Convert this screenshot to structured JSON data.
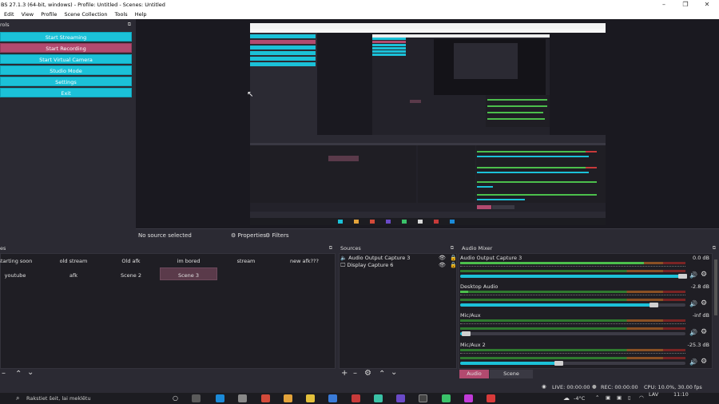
{
  "window": {
    "title": "BS 27.1.3 (64-bit, windows) - Profile: Untitled - Scenes: Untitled",
    "minimize": "–",
    "maximize": "❐",
    "close": "✕"
  },
  "menu": [
    "Edit",
    "View",
    "Profile",
    "Scene Collection",
    "Tools",
    "Help"
  ],
  "controls": {
    "title": "rols",
    "buttons": [
      "Start Streaming",
      "Start Recording",
      "Start Virtual Camera",
      "Studio Mode",
      "Settings",
      "Exit"
    ]
  },
  "source_bar": {
    "no_source": "No source selected",
    "properties": "Properties",
    "filters": "Filters"
  },
  "scenes": {
    "title": "es",
    "row1": [
      "starting soon",
      "old stream",
      "Old afk",
      "im bored",
      "stream",
      "new afk???"
    ],
    "row2": [
      "youtube",
      "afk",
      "Scene 2",
      "Scene 3"
    ],
    "toolbar": [
      "–",
      "⌃",
      "⌄"
    ]
  },
  "sources": {
    "title": "Sources",
    "items": [
      "Audio Output Capture 3",
      "Display Capture 6"
    ],
    "toolbar": [
      "+",
      "–",
      "⚙",
      "⌃",
      "⌄"
    ]
  },
  "mixer": {
    "title": "Audio Mixer",
    "channels": [
      {
        "name": "Audio Output Capture 3",
        "db": "0.0 dB",
        "level": 0.99
      },
      {
        "name": "Desktop Audio",
        "db": "-2.8 dB",
        "level": 0.86
      },
      {
        "name": "Mic/Aux",
        "db": "-inf dB",
        "level": 0.03
      },
      {
        "name": "Mic/Aux 2",
        "db": "-25.3 dB",
        "level": 0.44
      }
    ],
    "tabs": [
      "Audio Mixer",
      "Scene Transitions"
    ]
  },
  "status": {
    "live": "LIVE: 00:00:00",
    "rec": "REC: 00:00:00",
    "cpu": "CPU: 10.0%, 30.00 fps"
  },
  "taskbar": {
    "search_placeholder": "Rakstiet šeit, lai meklētu",
    "lang": "LAV",
    "time": "11:10",
    "temp": "-4°C"
  },
  "colors": {
    "accent": "#1bc1d8",
    "record": "#b24a6f",
    "meter_green": "#4cbf4c",
    "meter_orange": "#d7803a",
    "meter_red": "#c73a3a"
  }
}
